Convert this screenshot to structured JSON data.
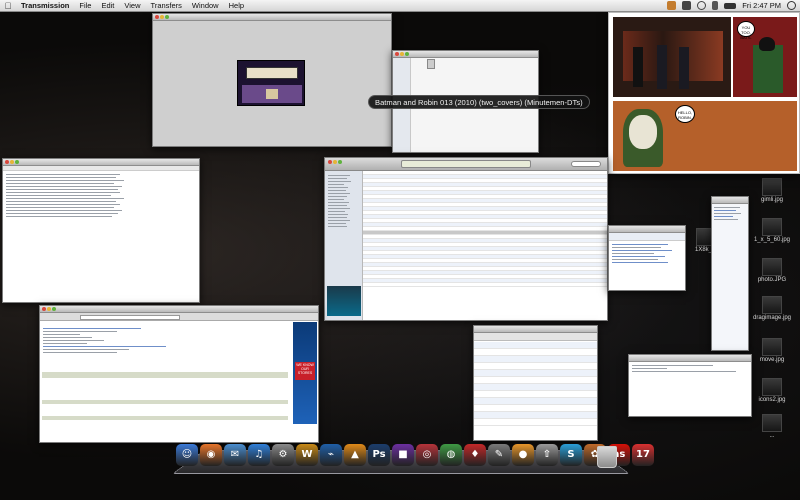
{
  "menubar": {
    "apple": "",
    "items": [
      "Transmission",
      "File",
      "Edit",
      "View",
      "Transfers",
      "Window",
      "Help"
    ],
    "clock": "Fri 2:47 PM"
  },
  "hover_label": "Batman and Robin 013 (2010) (two_covers) (Minutemen-DTs)",
  "comic": {
    "speech_1": "YOU TOO, BATS.",
    "speech_2": "HELLO, ROBIN."
  },
  "web_page": {
    "ad_text": "WE KNOW OUR STORES"
  },
  "desktop_icons": [
    {
      "label": "gimli.jpg"
    },
    {
      "label": "1X8k_..."
    },
    {
      "label": "1_x_5_60.jpg"
    },
    {
      "label": "photo.JPG"
    },
    {
      "label": "dragimage.jpg"
    },
    {
      "label": "move.jpg"
    },
    {
      "label": "icons2.jpg"
    },
    {
      "label": "..."
    }
  ],
  "dock": {
    "apps": [
      {
        "name": "finder",
        "glyph": "☺",
        "color": "#3b7ad8"
      },
      {
        "name": "firefox",
        "glyph": "◉",
        "color": "#e6742a"
      },
      {
        "name": "mail",
        "glyph": "✉",
        "color": "#4a8ed0"
      },
      {
        "name": "itunes",
        "glyph": "♫",
        "color": "#2f7fd8"
      },
      {
        "name": "system-prefs",
        "glyph": "⚙",
        "color": "#8a8a8a"
      },
      {
        "name": "winamp",
        "glyph": "W",
        "color": "#c98a16"
      },
      {
        "name": "app-blue",
        "glyph": "⌁",
        "color": "#1f5fa8"
      },
      {
        "name": "vlc",
        "glyph": "▲",
        "color": "#e08a18"
      },
      {
        "name": "photoshop",
        "glyph": "Ps",
        "color": "#1b3d6b"
      },
      {
        "name": "app-purple",
        "glyph": "■",
        "color": "#6b2fa0"
      },
      {
        "name": "transmission",
        "glyph": "◎",
        "color": "#b6333a"
      },
      {
        "name": "chrome",
        "glyph": "◍",
        "color": "#3f9a44"
      },
      {
        "name": "app-red",
        "glyph": "♦",
        "color": "#c42828"
      },
      {
        "name": "app-script",
        "glyph": "✎",
        "color": "#7a7a7a"
      },
      {
        "name": "app-orange",
        "glyph": "●",
        "color": "#e8962a"
      },
      {
        "name": "upload",
        "glyph": "⇧",
        "color": "#9a9a9a"
      },
      {
        "name": "skype",
        "glyph": "S",
        "color": "#2a9fd8"
      },
      {
        "name": "photos",
        "glyph": "✿",
        "color": "#c06a2a"
      },
      {
        "name": "lastfm",
        "glyph": "as",
        "color": "#d51007"
      },
      {
        "name": "ical",
        "glyph": "17",
        "color": "#d83030"
      }
    ],
    "trash_label": "Trash"
  }
}
